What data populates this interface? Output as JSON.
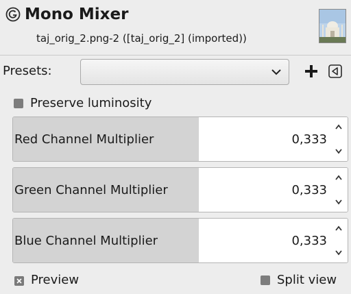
{
  "header": {
    "title": "Mono Mixer",
    "subtitle": "taj_orig_2.png-2 ([taj_orig_2] (imported))",
    "app_icon": "gimp-wilber-icon",
    "thumbnail_icon": "image-thumbnail"
  },
  "presets": {
    "label": "Presets:",
    "selected_value": "",
    "add_icon": "plus-icon",
    "menu_icon": "triangle-left-menu-icon"
  },
  "preserve_luminosity": {
    "label": "Preserve luminosity",
    "checked": false
  },
  "channels": [
    {
      "label": "Red Channel Multiplier",
      "value": "0,333",
      "fraction": 0.555
    },
    {
      "label": "Green Channel Multiplier",
      "value": "0,333",
      "fraction": 0.555
    },
    {
      "label": "Blue Channel Multiplier",
      "value": "0,333",
      "fraction": 0.555
    }
  ],
  "preview": {
    "label": "Preview",
    "checked": true
  },
  "split_view": {
    "label": "Split view",
    "checked": false
  },
  "colors": {
    "background": "#ededed",
    "slider_fill": "#d3d3d3",
    "checkbox": "#7d7d7d"
  }
}
